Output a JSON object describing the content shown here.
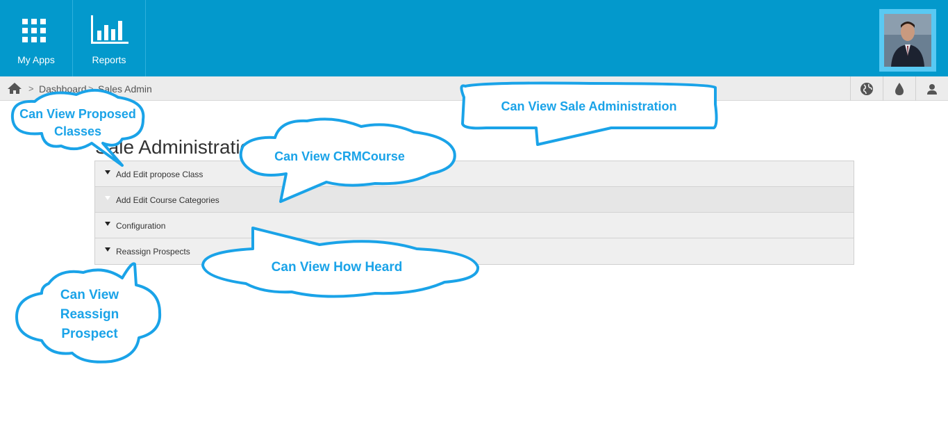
{
  "topbar": {
    "tiles": [
      {
        "label": "My Apps",
        "icon": "grid-icon"
      },
      {
        "label": "Reports",
        "icon": "bar-chart-icon"
      }
    ],
    "bg_color": "#0399cc"
  },
  "breadcrumb": {
    "items": [
      "Dashboard",
      "Sales Admin"
    ],
    "separator": ">"
  },
  "toolbar_icons": [
    "globe-icon",
    "drop-icon",
    "user-icon"
  ],
  "page": {
    "title": "Sale Administration",
    "sections": [
      {
        "label": "Add Edit propose Class"
      },
      {
        "label": "Add Edit Course Categories"
      },
      {
        "label": "Configuration"
      },
      {
        "label": "Reassign Prospects"
      }
    ]
  },
  "callouts": {
    "proposed": "Can View Proposed Classes",
    "sale_admin": "Can View Sale Administration",
    "crmcourse": "Can View CRMCourse",
    "how_heard": "Can View How Heard",
    "reassign": "Can View Reassign Prospect"
  },
  "colors": {
    "accent": "#0399cc",
    "callout": "#1aa3e8"
  }
}
